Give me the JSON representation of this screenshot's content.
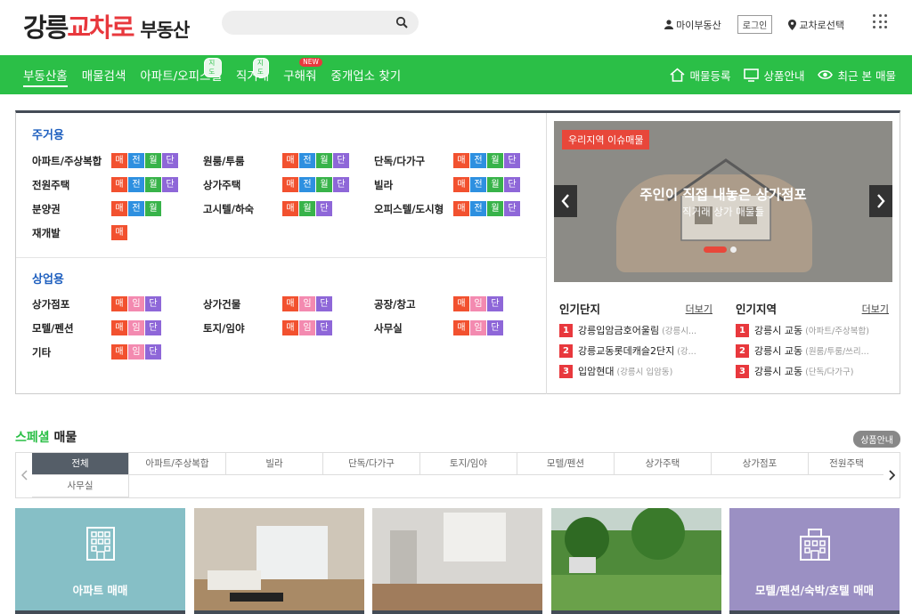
{
  "header": {
    "logo_part1": "강릉",
    "logo_part2": "교차로",
    "logo_part3": "부동산",
    "my_realty": "마이부동산",
    "login": "로그인",
    "region_select": "교차로선택"
  },
  "nav": {
    "items": [
      {
        "label": "부동산홈"
      },
      {
        "label": "매물검색"
      },
      {
        "label": "아파트/오피스텔",
        "badge": "지도"
      },
      {
        "label": "직거래",
        "badge": "지도"
      },
      {
        "label": "구해줘",
        "badge": "NEW"
      },
      {
        "label": "중개업소 찾기"
      }
    ],
    "right": [
      "매물등록",
      "상품안내",
      "최근 본 매물"
    ]
  },
  "tags": {
    "sale": "매",
    "jeon": "전",
    "wol": "월",
    "dan": "단",
    "im": "임"
  },
  "residential": {
    "title": "주거용",
    "rows": [
      [
        "아파트/주상복합",
        "원룸/투룸",
        "단독/다가구"
      ],
      [
        "전원주택",
        "상가주택",
        "빌라"
      ],
      [
        "분양권",
        "고시텔/하숙",
        "오피스텔/도시형"
      ],
      [
        "재개발"
      ]
    ]
  },
  "commercial": {
    "title": "상업용",
    "rows": [
      [
        "상가점포",
        "상가건물",
        "공장/창고"
      ],
      [
        "모텔/펜션",
        "토지/임야",
        "사무실"
      ],
      [
        "기타"
      ]
    ]
  },
  "banner": {
    "label": "우리지역 이슈매물",
    "title": "주인이 직접 내놓은 상가점포",
    "subtitle": "직거래 상가 매물들"
  },
  "popular_complex": {
    "title": "인기단지",
    "more": "더보기",
    "items": [
      {
        "rank": "1",
        "name": "강릉입암금호어울림",
        "loc": "(강릉시..."
      },
      {
        "rank": "2",
        "name": "강릉교동롯데캐슬2단지",
        "loc": "(강..."
      },
      {
        "rank": "3",
        "name": "입암현대",
        "loc": "(강릉시 입암동)"
      }
    ]
  },
  "popular_region": {
    "title": "인기지역",
    "more": "더보기",
    "items": [
      {
        "rank": "1",
        "name": "강릉시 교동",
        "loc": "(아파트/주상복합)"
      },
      {
        "rank": "2",
        "name": "강릉시 교동",
        "loc": "(원룸/투룸/쓰리..."
      },
      {
        "rank": "3",
        "name": "강릉시 교동",
        "loc": "(단독/다가구)"
      }
    ]
  },
  "special": {
    "title_green": "스페셜",
    "title_black": "매물",
    "guide": "상품안내",
    "tabs": [
      "전체",
      "아파트/주상복합",
      "빌라",
      "단독/다가구",
      "토지/임야",
      "모텔/펜션",
      "상가주택",
      "상가점포",
      "전원주택",
      "사무실"
    ]
  },
  "cards": [
    {
      "caption": "아파트 매매"
    },
    {
      "caption": ""
    },
    {
      "caption": ""
    },
    {
      "caption": ""
    },
    {
      "caption": "모텔/펜션/숙박/호텔 매매"
    }
  ],
  "colors": {
    "brand_green": "#2bbf47",
    "accent_red": "#e8383d",
    "link_blue": "#1e5fbf"
  }
}
